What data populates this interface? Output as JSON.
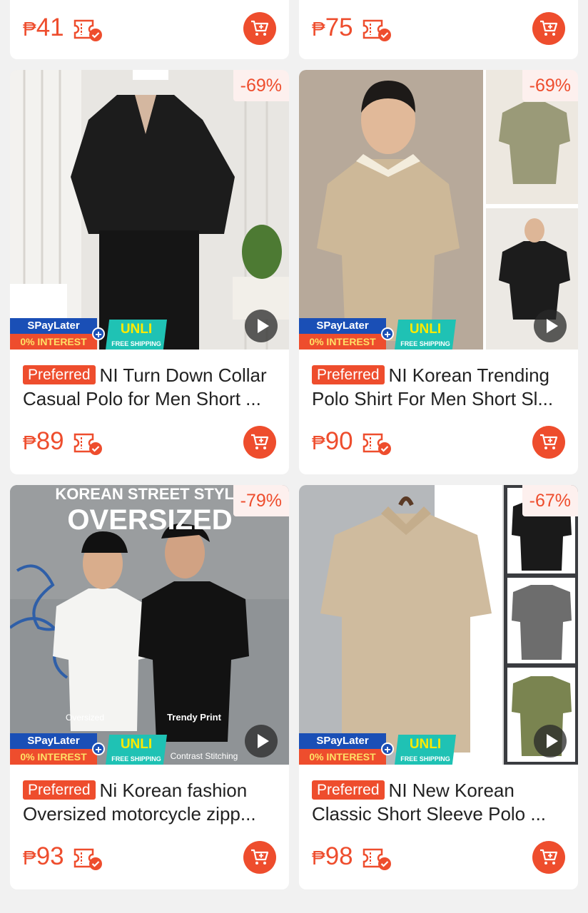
{
  "top_row": [
    {
      "currency": "₱",
      "price": "41"
    },
    {
      "currency": "₱",
      "price": "75"
    }
  ],
  "promo": {
    "spaylater": "SPayLater",
    "interest": "0% INTEREST",
    "unli": "UNLI",
    "free_shipping": "FREE SHIPPING"
  },
  "badge": "Preferred",
  "products": [
    {
      "title": "NI Turn Down Collar Casual Polo for Men Short ...",
      "currency": "₱",
      "price": "89",
      "discount": "-69%",
      "image": "black-polo-model-photo"
    },
    {
      "title": "NI Korean Trending Polo Shirt For Men Short Sl...",
      "currency": "₱",
      "price": "90",
      "discount": "-69%",
      "image": "beige-polo-model-collage"
    },
    {
      "title": "Ni Korean fashion Oversized motorcycle zipp...",
      "currency": "₱",
      "price": "93",
      "discount": "-79%",
      "image": "korean-street-style-oversized-photo",
      "image_text": {
        "headline1": "KOREAN STREET STYLE",
        "headline2": "OVERSIZED",
        "tag1": "Oversized",
        "tag2": "Trendy Print",
        "tag3": "Contrast Stitching"
      }
    },
    {
      "title": "NI New Korean Classic Short Sleeve Polo ...",
      "currency": "₱",
      "price": "98",
      "discount": "-67%",
      "image": "khaki-polo-hanger-photo"
    }
  ],
  "colors": {
    "brand": "#ee4d2d",
    "background": "#f1f1f1"
  }
}
